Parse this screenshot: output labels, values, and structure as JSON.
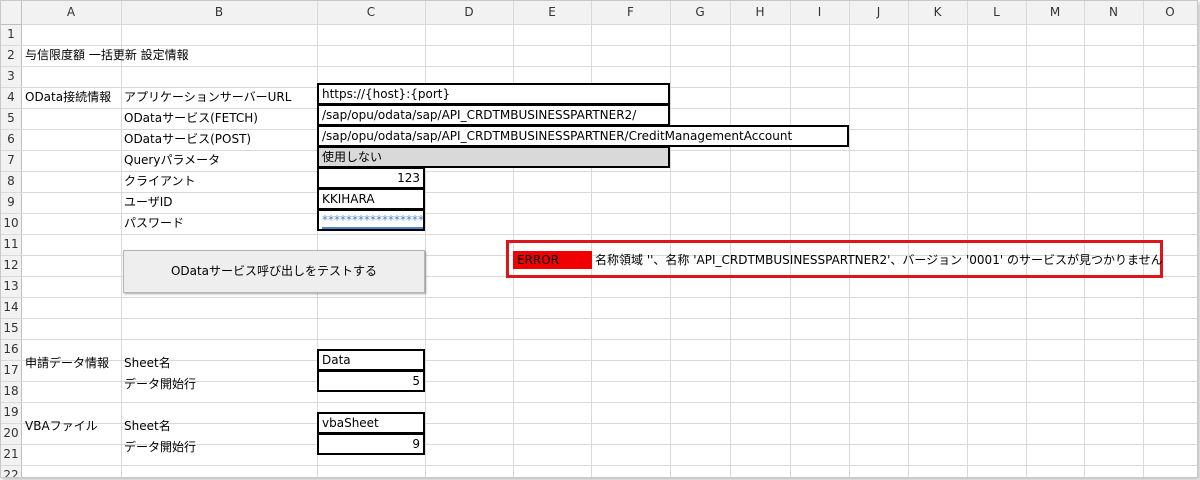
{
  "columns": [
    "A",
    "B",
    "C",
    "D",
    "E",
    "F",
    "G",
    "H",
    "I",
    "J",
    "K",
    "L",
    "M",
    "N",
    "O"
  ],
  "rows": [
    "1",
    "2",
    "3",
    "4",
    "5",
    "6",
    "7",
    "8",
    "9",
    "10",
    "11",
    "12",
    "13",
    "14",
    "15",
    "16",
    "17",
    "18",
    "19",
    "20",
    "21",
    "22"
  ],
  "title": "与信限度額 一括更新 設定情報",
  "odata": {
    "section_label": "OData接続情報",
    "app_server_label": "アプリケーションサーバーURL",
    "app_server_value": "https://{host}:{port}",
    "fetch_label": "ODataサービス(FETCH)",
    "fetch_value": "/sap/opu/odata/sap/API_CRDTMBUSINESSPARTNER2/",
    "post_label": "ODataサービス(POST)",
    "post_value": "/sap/opu/odata/sap/API_CRDTMBUSINESSPARTNER/CreditManagementAccount",
    "query_label": "Queryパラメータ",
    "query_value": "使用しない",
    "client_label": "クライアント",
    "client_value": "123",
    "user_label": "ユーザID",
    "user_value": "KKIHARA",
    "password_label": "パスワード",
    "password_value": "******************"
  },
  "test_button_label": "ODataサービス呼び出しをテストする",
  "error": {
    "tag": "ERROR",
    "message": "名称領域 ''、名称 'API_CRDTMBUSINESSPARTNER2'、バージョン '0001' のサービスが見つかりません",
    "frame_color": "#e0141b",
    "tag_color": "#f00000"
  },
  "request_data": {
    "section_label": "申請データ情報",
    "sheet_label": "Sheet名",
    "sheet_value": "Data",
    "start_row_label": "データ開始行",
    "start_row_value": "5"
  },
  "vba_file": {
    "section_label": "VBAファイル",
    "sheet_label": "Sheet名",
    "sheet_value": "vbaSheet",
    "start_row_label": "データ開始行",
    "start_row_value": "9"
  }
}
